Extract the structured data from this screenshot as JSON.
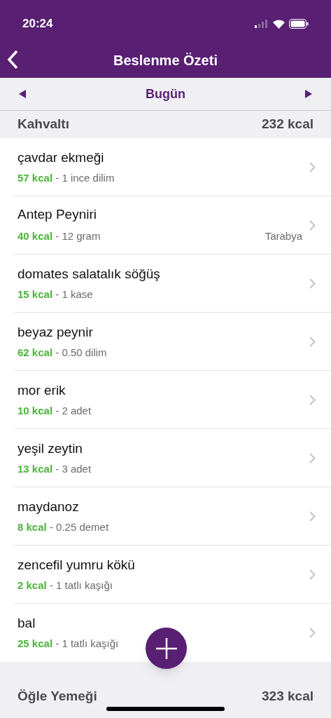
{
  "status_bar": {
    "time": "20:24"
  },
  "nav": {
    "title": "Beslenme Özeti"
  },
  "date_bar": {
    "label": "Bugün"
  },
  "sections": [
    {
      "name": "Kahvaltı",
      "total": "232 kcal",
      "items": [
        {
          "name": "çavdar ekmeği",
          "kcal": "57 kcal",
          "portion": "- 1 ince dilim"
        },
        {
          "name": "Antep Peyniri",
          "kcal": "40 kcal",
          "portion": "- 12 gram",
          "brand": "Tarabya"
        },
        {
          "name": "domates salatalık söğüş",
          "kcal": "15 kcal",
          "portion": "- 1 kase"
        },
        {
          "name": "beyaz peynir",
          "kcal": "62 kcal",
          "portion": "- 0.50 dilim"
        },
        {
          "name": "mor erik",
          "kcal": "10 kcal",
          "portion": "- 2 adet"
        },
        {
          "name": "yeşil zeytin",
          "kcal": "13 kcal",
          "portion": "- 3 adet"
        },
        {
          "name": "maydanoz",
          "kcal": "8 kcal",
          "portion": "- 0.25 demet"
        },
        {
          "name": "zencefil yumru kökü",
          "kcal": "2 kcal",
          "portion": "- 1 tatlı kaşığı"
        },
        {
          "name": "bal",
          "kcal": "25 kcal",
          "portion": "- 1 tatlı kaşığı"
        }
      ]
    },
    {
      "name": "Öğle Yemeği",
      "total": "323 kcal"
    }
  ]
}
